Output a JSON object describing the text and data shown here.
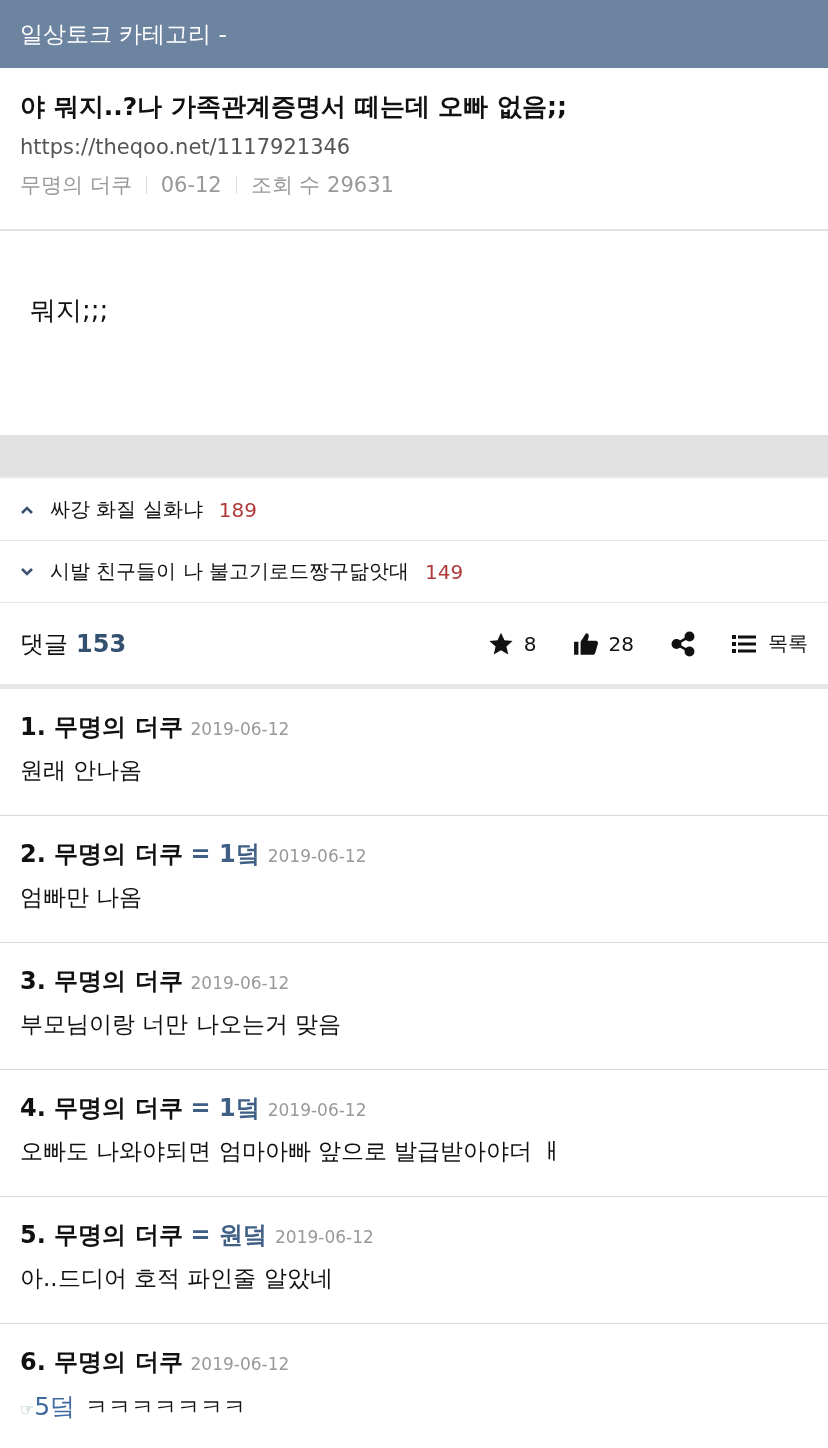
{
  "header": {
    "title": "일상토크 카테고리 -"
  },
  "post": {
    "title": "야 뭐지..?나 가족관계증명서 떼는데 오빠 없음;;",
    "url": "https://theqoo.net/1117921346",
    "author": "무명의 더쿠",
    "date": "06-12",
    "views": "조회 수 29631",
    "body": "뭐지;;;"
  },
  "nav": [
    {
      "kind": "prev",
      "title": "싸강 화질 실화냐",
      "count": "189"
    },
    {
      "kind": "next",
      "title": "시발 친구들이 나 불고기로드짱구닮앗대",
      "count": "149"
    }
  ],
  "toolbar": {
    "comments_label": "댓글",
    "comments_count": "153",
    "stars": "8",
    "likes": "28",
    "list_label": "목록"
  },
  "comments": [
    {
      "number": "1.",
      "author": "무명의 더쿠",
      "date": "2019-06-12",
      "body": "원래 안나옴"
    },
    {
      "number": "2.",
      "author": "무명의 더쿠",
      "tag": "= 1덬",
      "date": "2019-06-12",
      "body": "엄빠만 나옴"
    },
    {
      "number": "3.",
      "author": "무명의 더쿠",
      "date": "2019-06-12",
      "body": "부모님이랑 너만 나오는거 맞음"
    },
    {
      "number": "4.",
      "author": "무명의 더쿠",
      "tag": "= 1덬",
      "date": "2019-06-12",
      "body": "오빠도 나와야되면 엄마아빠 앞으로 발급받아야더 ㅐ"
    },
    {
      "number": "5.",
      "author": "무명의 더쿠",
      "tag": "= 원덬",
      "date": "2019-06-12",
      "body": "아..드디어 호적 파인줄 알았네"
    },
    {
      "number": "6.",
      "author": "무명의 더쿠",
      "date": "2019-06-12",
      "reply_mark": "☞",
      "reply_to": "5덬",
      "body": "ㅋㅋㅋㅋㅋㅋㅋ"
    }
  ]
}
